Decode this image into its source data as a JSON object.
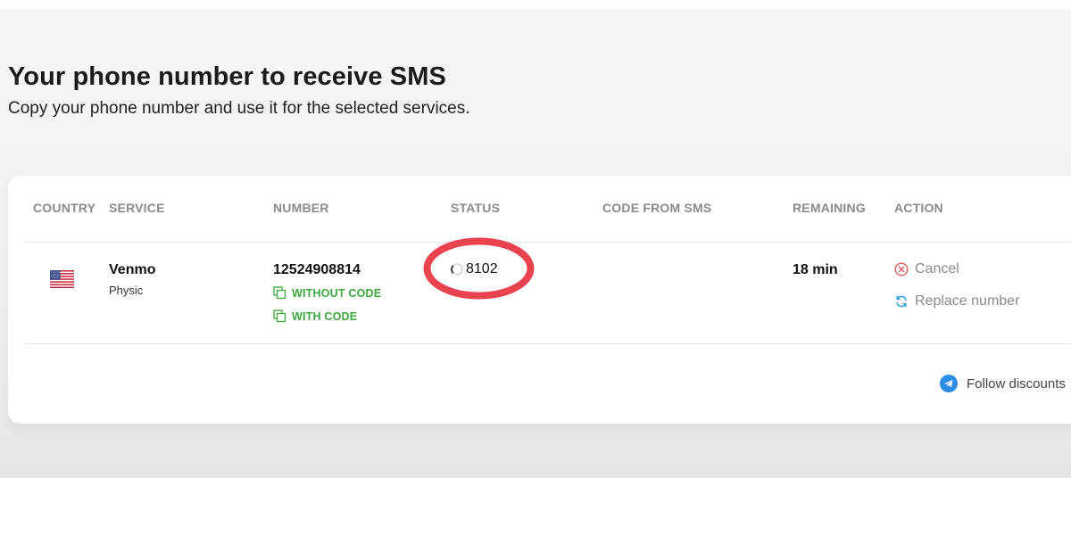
{
  "page": {
    "title": "Your phone number to receive SMS",
    "subtitle": "Copy your phone number and use it for the selected services."
  },
  "table": {
    "headers": {
      "country": "COUNTRY",
      "service": "SERVICE",
      "number": "NUMBER",
      "status": "STATUS",
      "code_from_sms": "CODE FROM SMS",
      "remaining": "REMAINING",
      "action": "ACTION"
    },
    "rows": [
      {
        "country_icon": "us-flag-icon",
        "service": "Venmo",
        "service_sub": "Physic",
        "number": "12524908814",
        "copy_without_code": "WITHOUT CODE",
        "copy_with_code": "WITH CODE",
        "status": "8102",
        "code_from_sms": "",
        "remaining": "18 min",
        "actions": {
          "cancel": "Cancel",
          "replace": "Replace number"
        }
      }
    ]
  },
  "footer": {
    "follow_label": "Follow discounts"
  },
  "colors": {
    "accent_green": "#3aa83a",
    "cancel_red": "#e05a5a",
    "replace_blue": "#2a9fd6",
    "annotation_red": "#e8434f",
    "telegram_blue": "#2a8ee6"
  }
}
